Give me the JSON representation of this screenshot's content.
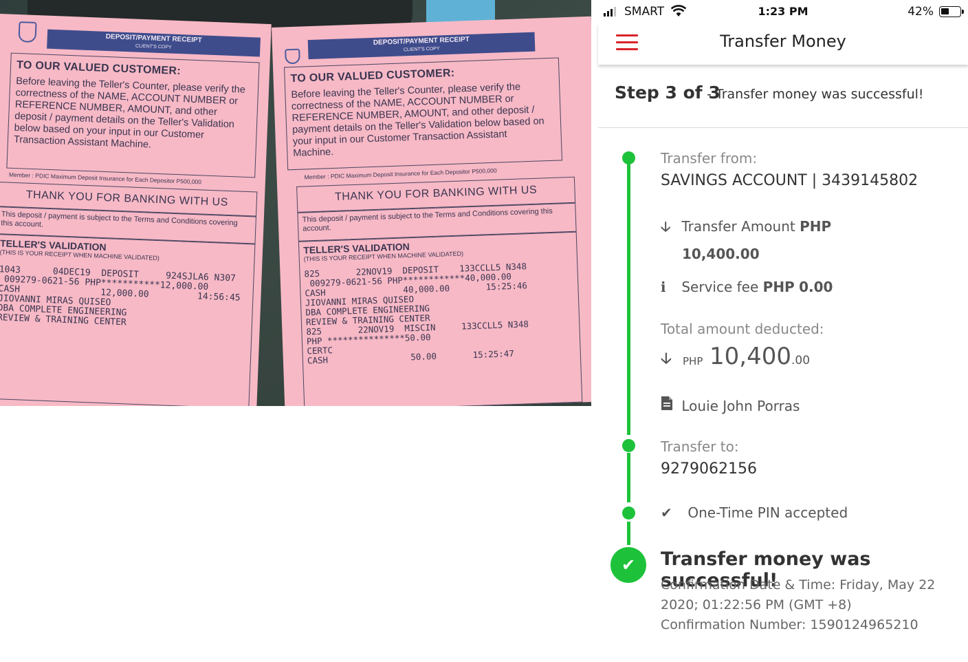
{
  "receipts": [
    {
      "header": "DEPOSIT/PAYMENT RECEIPT",
      "copy": "CLIENT'S COPY",
      "greeting": "TO OUR VALUED CUSTOMER:",
      "body": "Before leaving the Teller's Counter, please verify the correctness of the NAME, ACCOUNT NUMBER or REFERENCE NUMBER, AMOUNT, and other deposit / payment details on the Teller's Validation below based on your input in our Customer Transaction Assistant Machine.",
      "member": "Member : PDIC Maximum Deposit Insurance for Each Depositor P500,000",
      "thanks": "THANK YOU FOR BANKING WITH US",
      "terms": "This deposit / payment is subject to the Terms and Conditions covering this account.",
      "validation_title": "TELLER'S VALIDATION",
      "validation_sub": "(THIS IS YOUR RECEIPT WHEN MACHINE VALIDATED)",
      "print_lines": [
        "1043      04DEC19  DEPOSIT     924SJLA6 N307",
        " 009279-0621-56 PHP***********12,000.00",
        "CASH               12,000.00         14:56:45",
        "",
        "JIOVANNI MIRAS QUISEO",
        "DBA COMPLETE ENGINEERING",
        "REVIEW & TRAINING CENTER"
      ]
    },
    {
      "header": "DEPOSIT/PAYMENT RECEIPT",
      "copy": "CLIENT'S COPY",
      "greeting": "TO OUR VALUED CUSTOMER:",
      "body": "Before leaving the Teller's Counter, please verify the correctness of the NAME, ACCOUNT NUMBER or REFERENCE NUMBER, AMOUNT, and other deposit / payment details on the Teller's Validation below based on your input in our Customer Transaction Assistant Machine.",
      "member": "Member : PDIC Maximum Deposit Insurance for Each Depositor P500,000",
      "thanks": "THANK YOU FOR BANKING WITH US",
      "terms": "This deposit / payment is subject to the Terms and Conditions covering this account.",
      "validation_title": "TELLER'S VALIDATION",
      "validation_sub": "(THIS IS YOUR RECEIPT WHEN MACHINE VALIDATED)",
      "print_lines": [
        "825       22NOV19  DEPOSIT    133CCLL5 N348",
        " 009279-0621-56 PHP************40,000.00",
        "CASH               40,000.00       15:25:46",
        "JIOVANNI MIRAS QUISEO",
        "DBA COMPLETE ENGINEERING",
        "REVIEW & TRAINING CENTER",
        "",
        "825       22NOV19  MISCIN     133CCLL5 N348",
        "PHP ***************50.00",
        "CERTC",
        "CASH                50.00       15:25:47"
      ]
    }
  ],
  "status_bar": {
    "carrier": "SMART",
    "time": "1:23 PM",
    "battery": "42%",
    "battery_level": 0.42,
    "signal_bars": 3
  },
  "nav": {
    "title": "Transfer Money",
    "menu_icon": "hamburger-menu-icon"
  },
  "step": {
    "label": "Step 3 of 3",
    "description": "- Transfer money was successful!"
  },
  "transfer": {
    "from_label": "Transfer from:",
    "from_value": "SAVINGS ACCOUNT | 3439145802",
    "amount_label": "Transfer Amount",
    "amount_currency": "PHP",
    "amount_value": "10,400.00",
    "fee_label": "Service fee",
    "fee_currency": "PHP",
    "fee_value": "0.00",
    "total_label": "Total amount deducted:",
    "total_currency": "PHP",
    "total_whole": "10,400",
    "total_cents": ".00",
    "recipient_name": "Louie John Porras",
    "to_label": "Transfer to:",
    "to_value": "9279062156",
    "otp_text": "One-Time PIN accepted",
    "success_title": "Transfer money was successful!",
    "confirm_line1": "Confirmation Date & Time: Friday, May 22",
    "confirm_line2": "2020; 01:22:56 PM (GMT +8)",
    "confirm_line3": "Confirmation Number: 1590124965210"
  },
  "colors": {
    "accent_red": "#d8232a",
    "timeline_green": "#1ec23a",
    "receipt_pink": "#f7b9c6",
    "receipt_header_blue": "#3f4c8c"
  }
}
